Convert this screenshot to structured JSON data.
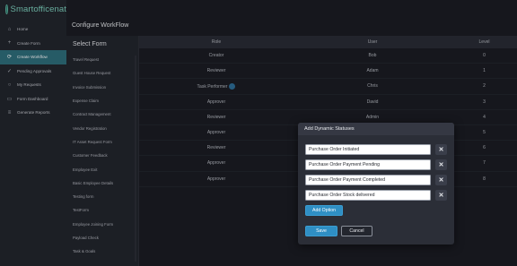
{
  "app": {
    "brand": "Smartofficenat"
  },
  "sidebar": {
    "items": [
      {
        "label": "Home",
        "icon": "home-icon",
        "glyph": "⌂"
      },
      {
        "label": "Create Form",
        "icon": "plus-icon",
        "glyph": "+"
      },
      {
        "label": "Create Workflow",
        "icon": "workflow-icon",
        "glyph": "⟳"
      },
      {
        "label": "Pending Approvals",
        "icon": "thumbs-up-icon",
        "glyph": "✓"
      },
      {
        "label": "My Requests",
        "icon": "requests-icon",
        "glyph": "○"
      },
      {
        "label": "Form Dashboard",
        "icon": "dashboard-icon",
        "glyph": "▭"
      },
      {
        "label": "Generate Reports",
        "icon": "report-icon",
        "glyph": "≡"
      }
    ]
  },
  "page": {
    "title": "Configure WorkFlow"
  },
  "forms": {
    "title": "Select Form",
    "items": [
      "Travel Request",
      "Guest House Request",
      "Invoice Submission",
      "Expense Claim",
      "Contract Management",
      "Vendor Registration",
      "IT Asset Request Form",
      "Customer Feedback",
      "Employee Exit",
      "Basic Employee Details",
      "Testing form",
      "TestForm",
      "Employee Joining Form",
      "Payload Check",
      "Task & Goals"
    ]
  },
  "workflow": {
    "headers": {
      "role": "Role",
      "user": "User",
      "level": "Level"
    },
    "rows": [
      {
        "role": "Creator",
        "user": "Bob",
        "level": "0"
      },
      {
        "role": "Reviewer",
        "user": "Adam",
        "level": "1"
      },
      {
        "role": "Task Performer",
        "user": "Chris",
        "level": "2"
      },
      {
        "role": "Approver",
        "user": "David",
        "level": "3"
      },
      {
        "role": "Reviewer",
        "user": "Admin",
        "level": "4"
      },
      {
        "role": "Approver",
        "user": "",
        "level": "5"
      },
      {
        "role": "Reviewer",
        "user": "",
        "level": "6"
      },
      {
        "role": "Approver",
        "user": "",
        "level": "7"
      },
      {
        "role": "Approver",
        "user": "",
        "level": "8"
      }
    ]
  },
  "modal": {
    "title": "Add Dynamic Statuses",
    "statuses": [
      "Purchase Order Initiated",
      "Purchase Order Payment Pending",
      "Purchase Order Payment Completed",
      "Purchase Order Stock delivered"
    ],
    "remove_glyph": "✕",
    "add_option_label": "Add Option",
    "save_label": "Save",
    "cancel_label": "Cancel"
  },
  "colors": {
    "accent": "#2f8fc4",
    "sidebar_active": "#2f6f7d",
    "background": "#1b1d24"
  }
}
